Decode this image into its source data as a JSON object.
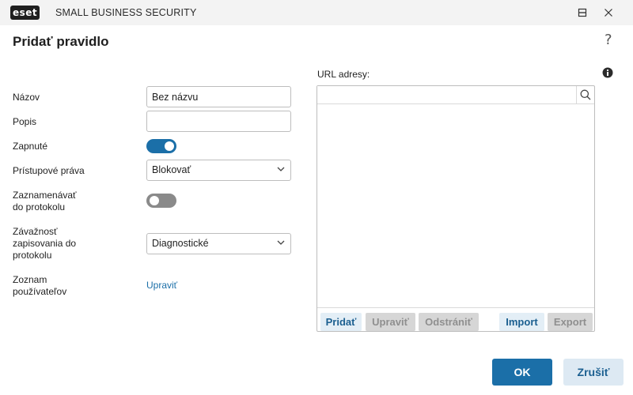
{
  "window": {
    "logo_text": "eset",
    "product_name": "SMALL BUSINESS SECURITY"
  },
  "page": {
    "title": "Pridať pravidlo",
    "help_glyph": "?"
  },
  "form": {
    "name_label": "Názov",
    "name_value": "Bez názvu",
    "description_label": "Popis",
    "description_value": "",
    "enabled_label": "Zapnuté",
    "enabled_state": "on",
    "access_label": "Prístupové práva",
    "access_value": "Blokovať",
    "log_label_line1": "Zaznamenávať",
    "log_label_line2": "do protokolu",
    "log_state": "off",
    "severity_label_line1": "Závažnosť",
    "severity_label_line2": "zapisovania do",
    "severity_label_line3": "protokolu",
    "severity_value": "Diagnostické",
    "users_label_line1": "Zoznam",
    "users_label_line2": "používateľov",
    "users_edit_link": "Upraviť"
  },
  "url_panel": {
    "label": "URL adresy:",
    "search_value": "",
    "buttons": {
      "add": "Pridať",
      "edit": "Upraviť",
      "remove": "Odstrániť",
      "import": "Import",
      "export": "Export"
    }
  },
  "footer": {
    "ok": "OK",
    "cancel": "Zrušiť"
  },
  "colors": {
    "accent": "#1b6fa8",
    "toggle_off": "#8a8a8a",
    "titlebar": "#f3f3f3"
  },
  "icons": {
    "minimize": "minimize-icon",
    "maximize": "maximize-icon",
    "close": "close-icon",
    "chevron": "chevron-down-icon",
    "search": "search-icon",
    "info": "info-icon"
  }
}
